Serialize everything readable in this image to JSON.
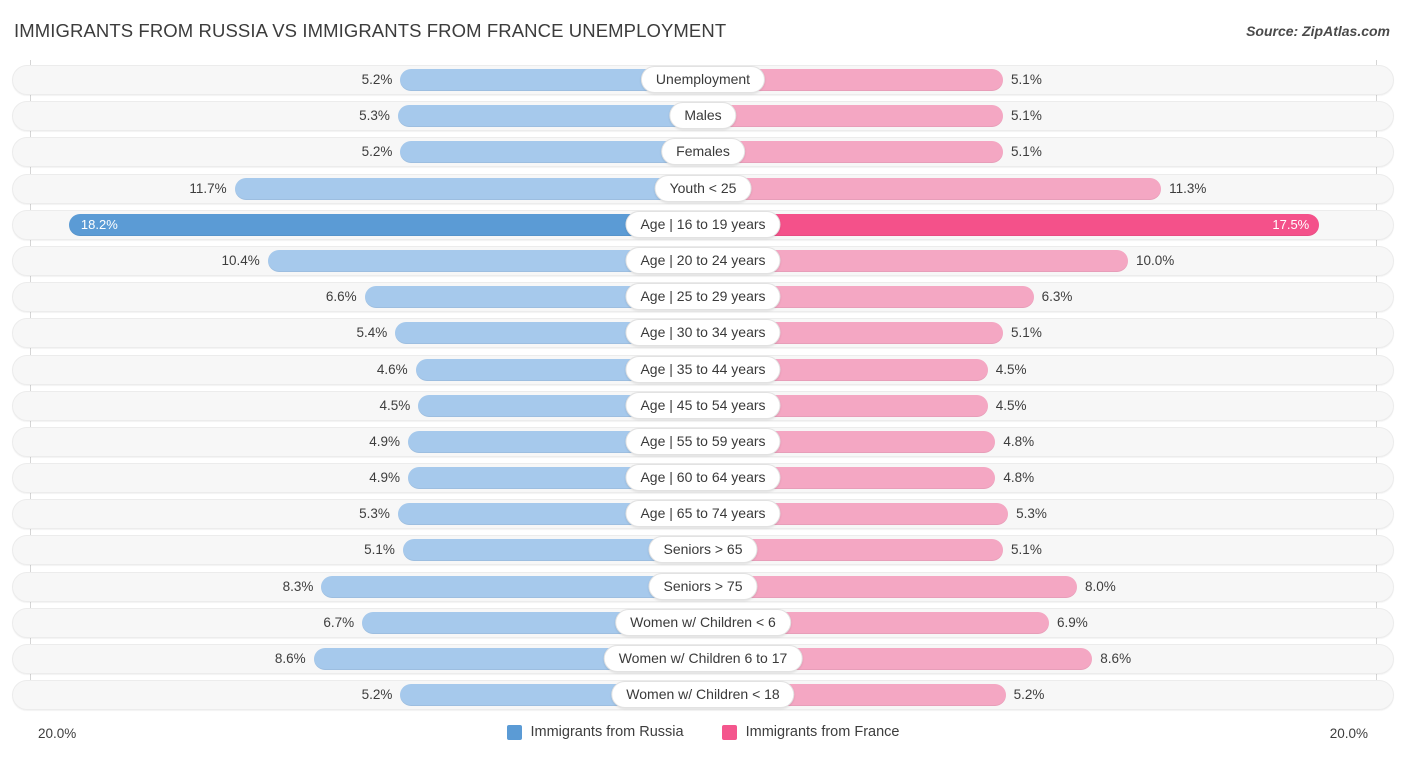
{
  "header": {
    "title": "IMMIGRANTS FROM RUSSIA VS IMMIGRANTS FROM FRANCE UNEMPLOYMENT",
    "source": "Source: ZipAtlas.com"
  },
  "axis": {
    "left_max_label": "20.0%",
    "right_max_label": "20.0%"
  },
  "legend": [
    {
      "label": "Immigrants from Russia",
      "color": "#5b9bd5"
    },
    {
      "label": "Immigrants from France",
      "color": "#f4568d"
    }
  ],
  "colors": {
    "left_bar": "#a6c9ec",
    "right_bar": "#f4a7c3",
    "left_bar_highlight": "#5b9bd5",
    "right_bar_highlight": "#f4518a",
    "track": "#f7f7f7",
    "gridline": "#d5d5d5"
  },
  "chart_data": {
    "type": "bar",
    "title": "IMMIGRANTS FROM RUSSIA VS IMMIGRANTS FROM FRANCE UNEMPLOYMENT",
    "subtype": "diverging-bidirectional",
    "xlabel": "",
    "ylabel": "",
    "xlim": [
      20.0,
      20.0
    ],
    "grid": true,
    "legend_position": "bottom-center",
    "categories": [
      "Unemployment",
      "Males",
      "Females",
      "Youth < 25",
      "Age | 16 to 19 years",
      "Age | 20 to 24 years",
      "Age | 25 to 29 years",
      "Age | 30 to 34 years",
      "Age | 35 to 44 years",
      "Age | 45 to 54 years",
      "Age | 55 to 59 years",
      "Age | 60 to 64 years",
      "Age | 65 to 74 years",
      "Seniors > 65",
      "Seniors > 75",
      "Women w/ Children < 6",
      "Women w/ Children 6 to 17",
      "Women w/ Children < 18"
    ],
    "series": [
      {
        "name": "Immigrants from Russia",
        "side": "left",
        "values": [
          5.2,
          5.3,
          5.2,
          11.7,
          18.2,
          10.4,
          6.6,
          5.4,
          4.6,
          4.5,
          4.9,
          4.9,
          5.3,
          5.1,
          8.3,
          6.7,
          8.6,
          5.2
        ],
        "labels": [
          "5.2%",
          "5.3%",
          "5.2%",
          "11.7%",
          "18.2%",
          "10.4%",
          "6.6%",
          "5.4%",
          "4.6%",
          "4.5%",
          "4.9%",
          "4.9%",
          "5.3%",
          "5.1%",
          "8.3%",
          "6.7%",
          "8.6%",
          "5.2%"
        ]
      },
      {
        "name": "Immigrants from France",
        "side": "right",
        "values": [
          5.1,
          5.1,
          5.1,
          11.3,
          17.5,
          10.0,
          6.3,
          5.1,
          4.5,
          4.5,
          4.8,
          4.8,
          5.3,
          5.1,
          8.0,
          6.9,
          8.6,
          5.2
        ],
        "labels": [
          "5.1%",
          "5.1%",
          "5.1%",
          "11.3%",
          "17.5%",
          "10.0%",
          "6.3%",
          "5.1%",
          "4.5%",
          "4.5%",
          "4.8%",
          "4.8%",
          "5.3%",
          "5.1%",
          "8.0%",
          "6.9%",
          "8.6%",
          "5.2%"
        ]
      }
    ],
    "highlighted_category": "Age | 16 to 19 years"
  }
}
